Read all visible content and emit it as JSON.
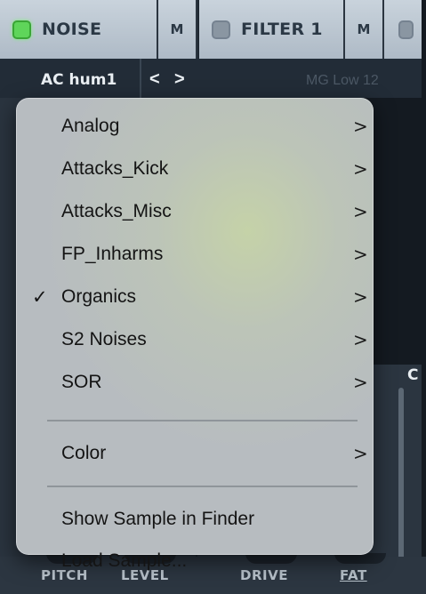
{
  "tabs": {
    "noise": {
      "title": "NOISE",
      "mute": "M",
      "led": "on"
    },
    "filter1": {
      "title": "FILTER 1",
      "mute": "M",
      "led": "off"
    }
  },
  "preset": {
    "name": "AC hum1",
    "prev": "<",
    "next": ">",
    "filter_preset": "MG Low 12"
  },
  "side_letter": "C",
  "knob_labels": {
    "pitch": "PITCH",
    "level": "LEVEL",
    "drive": "DRIVE",
    "fat": "FAT"
  },
  "menu": {
    "categories": [
      {
        "label": "Analog",
        "checked": false
      },
      {
        "label": "Attacks_Kick",
        "checked": false
      },
      {
        "label": "Attacks_Misc",
        "checked": false
      },
      {
        "label": "FP_Inharms",
        "checked": false
      },
      {
        "label": "Organics",
        "checked": true
      },
      {
        "label": "S2 Noises",
        "checked": false
      },
      {
        "label": "SOR",
        "checked": false
      }
    ],
    "color_label": "Color",
    "show_in_finder": "Show Sample in Finder",
    "load_sample": "Load Sample...",
    "submenu_glyph": ">",
    "check_glyph": "✓"
  },
  "colors": {
    "led_on": "#5fd55a",
    "tab_bg": "#c9d3dc",
    "menu_bg": "#b7bcc0"
  }
}
